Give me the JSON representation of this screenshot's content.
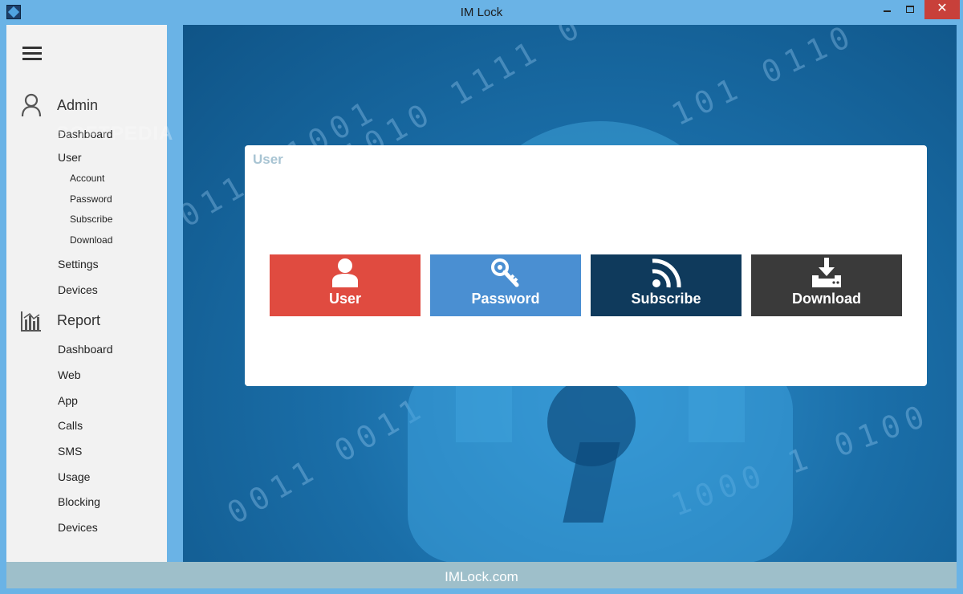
{
  "window": {
    "title": "IM Lock",
    "minimize_glyph": "—",
    "maximize_glyph": "□",
    "close_glyph": "✕"
  },
  "sidebar": {
    "admin": {
      "title": "Admin",
      "icon": "person-outline-icon",
      "items": [
        {
          "label": "Dashboard"
        },
        {
          "label": "User"
        },
        {
          "label": "Settings"
        },
        {
          "label": "Devices"
        }
      ],
      "user_subitems": [
        {
          "label": "Account"
        },
        {
          "label": "Password"
        },
        {
          "label": "Subscribe"
        },
        {
          "label": "Download"
        }
      ]
    },
    "report": {
      "title": "Report",
      "icon": "bar-chart-icon",
      "items": [
        {
          "label": "Dashboard"
        },
        {
          "label": "Web"
        },
        {
          "label": "App"
        },
        {
          "label": "Calls"
        },
        {
          "label": "SMS"
        },
        {
          "label": "Usage"
        },
        {
          "label": "Blocking"
        },
        {
          "label": "Devices"
        }
      ]
    }
  },
  "main": {
    "watermark": "SOFTPEDIA",
    "card": {
      "title": "User",
      "tiles": [
        {
          "label": "User",
          "icon": "user-icon",
          "color": "#e04b40"
        },
        {
          "label": "Password",
          "icon": "key-icon",
          "color": "#4a8fd2"
        },
        {
          "label": "Subscribe",
          "icon": "rss-icon",
          "color": "#0f3a5c"
        },
        {
          "label": "Download",
          "icon": "download-icon",
          "color": "#3a3a3a"
        }
      ]
    }
  },
  "footer": {
    "text": "IMLock.com"
  },
  "colors": {
    "window_frame": "#6ab3e6",
    "sidebar_bg": "#f2f2f2",
    "footer_bg": "#9ebfca",
    "card_title": "#a8c4d3"
  }
}
